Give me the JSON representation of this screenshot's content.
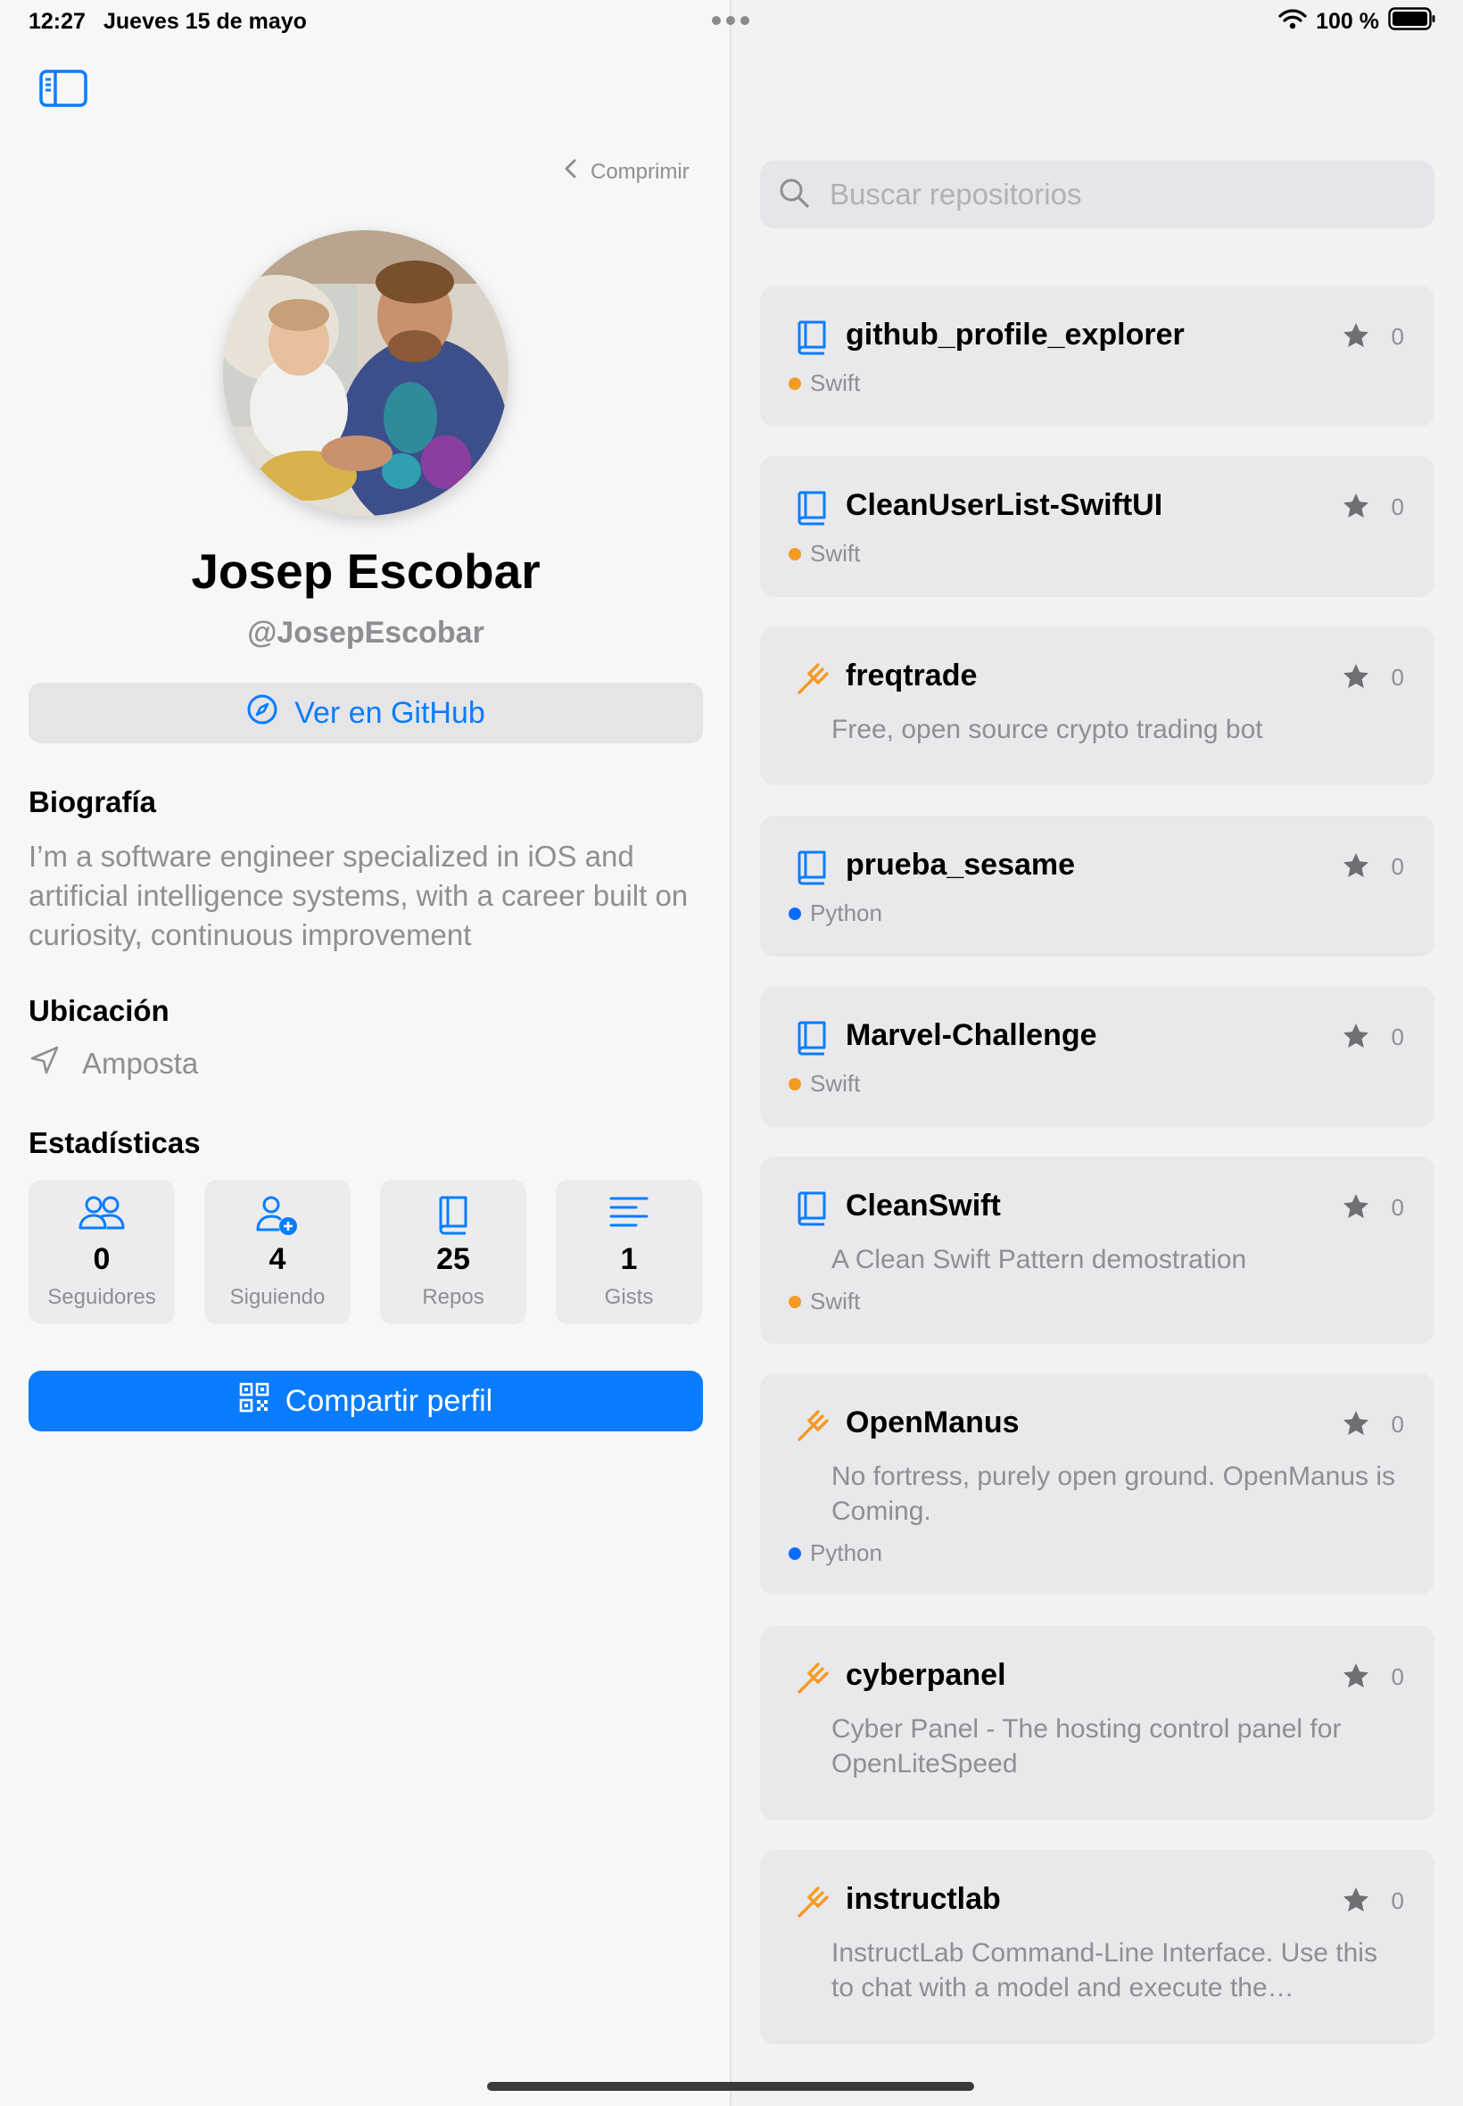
{
  "status_bar": {
    "time": "12:27",
    "date": "Jueves 15 de mayo",
    "battery": "100 %"
  },
  "profile": {
    "collapse_label": "Comprimir",
    "name": "Josep Escobar",
    "handle": "@JosepEscobar",
    "github_button_label": "Ver en GitHub",
    "bio_title": "Biografía",
    "bio": "I’m a software engineer specialized in iOS and artificial intelligence systems, with a career built on curiosity, continuous improvement",
    "location_title": "Ubicación",
    "location": "Amposta",
    "stats_title": "Estadísticas",
    "stats": [
      {
        "value": "0",
        "label": "Seguidores",
        "icon": "people-icon"
      },
      {
        "value": "4",
        "label": "Siguiendo",
        "icon": "person-add-icon"
      },
      {
        "value": "25",
        "label": "Repos",
        "icon": "book-icon"
      },
      {
        "value": "1",
        "label": "Gists",
        "icon": "lines-icon"
      }
    ],
    "share_button_label": "Compartir perfil"
  },
  "search": {
    "placeholder": "Buscar repositorios"
  },
  "repos": [
    {
      "name": "github_profile_explorer",
      "stars": "0",
      "icon": "book-icon",
      "description": "",
      "language": "Swift"
    },
    {
      "name": "CleanUserList-SwiftUI",
      "stars": "0",
      "icon": "book-icon",
      "description": "",
      "language": "Swift"
    },
    {
      "name": "freqtrade",
      "stars": "0",
      "icon": "fork-icon",
      "description": "Free, open source crypto trading bot",
      "language": ""
    },
    {
      "name": "prueba_sesame",
      "stars": "0",
      "icon": "book-icon",
      "description": "",
      "language": "Python"
    },
    {
      "name": "Marvel-Challenge",
      "stars": "0",
      "icon": "book-icon",
      "description": "",
      "language": "Swift"
    },
    {
      "name": "CleanSwift",
      "stars": "0",
      "icon": "book-icon",
      "description": "A Clean Swift Pattern demostration",
      "language": "Swift"
    },
    {
      "name": "OpenManus",
      "stars": "0",
      "icon": "fork-icon",
      "description": "No fortress, purely open ground.  OpenManus is Coming.",
      "language": "Python"
    },
    {
      "name": "cyberpanel",
      "stars": "0",
      "icon": "fork-icon",
      "description": "Cyber Panel - The hosting control panel for OpenLiteSpeed",
      "language": ""
    },
    {
      "name": "instructlab",
      "stars": "0",
      "icon": "fork-icon",
      "description": "InstructLab Command-Line Interface.  Use this to chat with a model and execute the InstructLab workflow to train a model using custom taxonomy data.",
      "language": ""
    }
  ],
  "colors": {
    "accent": "#0a7cff",
    "fork": "#f59a23",
    "swift": "#f59a23",
    "python": "#0a6cff"
  }
}
